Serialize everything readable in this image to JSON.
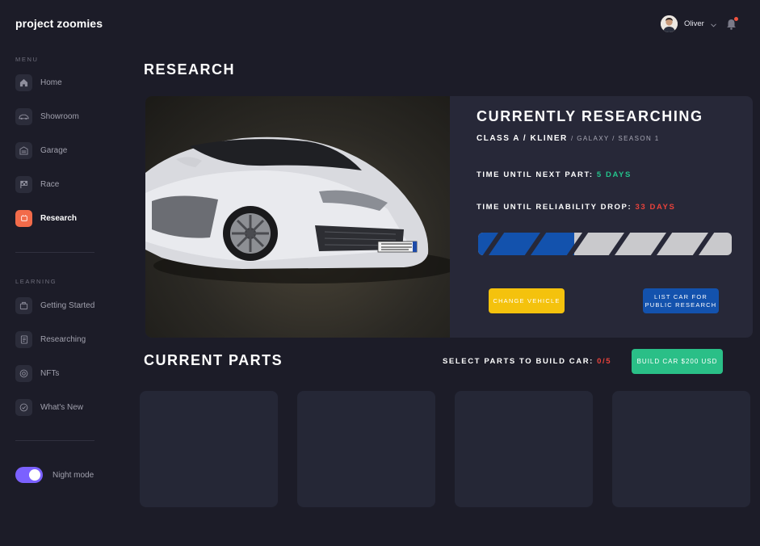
{
  "app": {
    "brand": "project zoomies"
  },
  "sidebar": {
    "menu_label": "MENU",
    "items": [
      {
        "label": "Home",
        "icon": "home-icon"
      },
      {
        "label": "Showroom",
        "icon": "car-icon"
      },
      {
        "label": "Garage",
        "icon": "garage-icon"
      },
      {
        "label": "Race",
        "icon": "flag-icon"
      },
      {
        "label": "Research",
        "icon": "research-icon",
        "active": true
      }
    ],
    "learning_label": "LEARNING",
    "learning_items": [
      {
        "label": "Getting Started",
        "icon": "briefcase-icon"
      },
      {
        "label": "Researching",
        "icon": "document-icon"
      },
      {
        "label": "NFTs",
        "icon": "coin-icon"
      },
      {
        "label": "What's New",
        "icon": "check-circle-icon"
      }
    ],
    "night_mode_label": "Night mode",
    "night_mode_on": true
  },
  "header": {
    "user_name": "Oliver",
    "has_notification": true
  },
  "page": {
    "title": "RESEARCH"
  },
  "research": {
    "title": "CURRENTLY RESEARCHING",
    "class_line": "CLASS A / KLINER",
    "meta_line": "/ GALAXY / SEASON 1",
    "next_part_label": "TIME UNTIL NEXT PART:",
    "next_part_value": "5 DAYS",
    "reliability_label": "TIME UNTIL RELIABILITY DROP:",
    "reliability_value": "33 DAYS",
    "progress_fraction": 0.38,
    "change_vehicle_label": "CHANGE VEHICLE",
    "list_car_label": "LIST CAR FOR PUBLIC RESEARCH"
  },
  "parts": {
    "title": "CURRENT PARTS",
    "select_label": "SELECT PARTS TO BUILD CAR:",
    "select_count": "0/5",
    "build_label": "BUILD CAR $200 USD"
  },
  "colors": {
    "accent_orange": "#f26b4a",
    "accent_green": "#24c38b",
    "accent_red": "#e8423b",
    "accent_blue": "#1352ad",
    "accent_yellow": "#f4c20d",
    "toggle_purple": "#7b61ff"
  }
}
